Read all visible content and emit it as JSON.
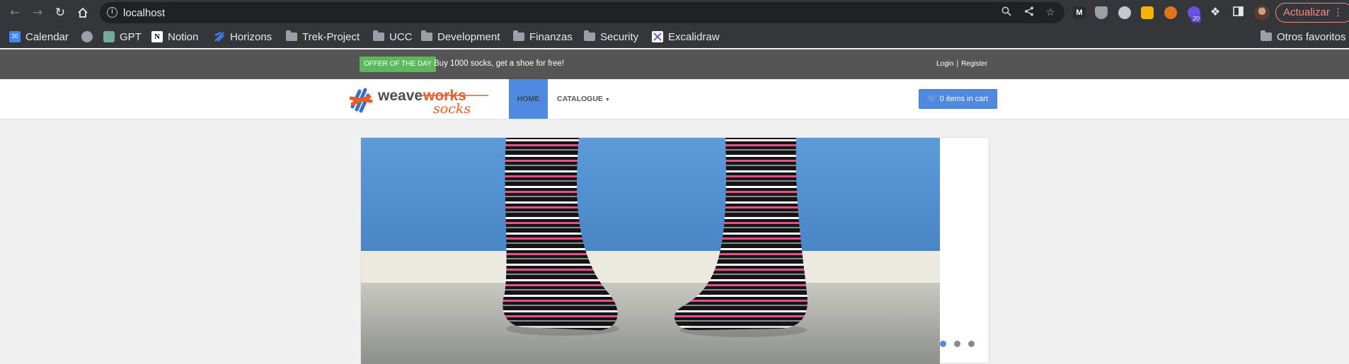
{
  "browser": {
    "url": "localhost",
    "update_label": "Actualizar",
    "extension_badge": "20",
    "bookmarks": [
      {
        "label": "Calendar",
        "icon": "calendar-icon"
      },
      {
        "label": "",
        "icon": "globe-icon"
      },
      {
        "label": "GPT",
        "icon": "openai-icon"
      },
      {
        "label": "Notion",
        "icon": "notion-icon"
      },
      {
        "label": "Horizons",
        "icon": "horizons-icon"
      },
      {
        "label": "Trek-Project",
        "icon": "folder-icon"
      },
      {
        "label": "UCC",
        "icon": "folder-icon"
      },
      {
        "label": "Development",
        "icon": "folder-icon"
      },
      {
        "label": "Finanzas",
        "icon": "folder-icon"
      },
      {
        "label": "Security",
        "icon": "folder-icon"
      },
      {
        "label": "Excalidraw",
        "icon": "excalidraw-icon"
      }
    ],
    "other_bookmarks": "Otros favoritos"
  },
  "site": {
    "offer_badge": "OFFER OF THE DAY",
    "offer_text": "Buy 1000 socks, get a shoe for free!",
    "login": "Login",
    "separator": "|",
    "register": "Register",
    "logo_word1": "weave",
    "logo_word2": "works",
    "logo_sub": "socks",
    "nav_home": "HOME",
    "nav_catalogue": "CATALOGUE",
    "cart_label": "0 items in cart",
    "accent_color": "#4f89e0",
    "offer_color": "#5cb85c"
  }
}
